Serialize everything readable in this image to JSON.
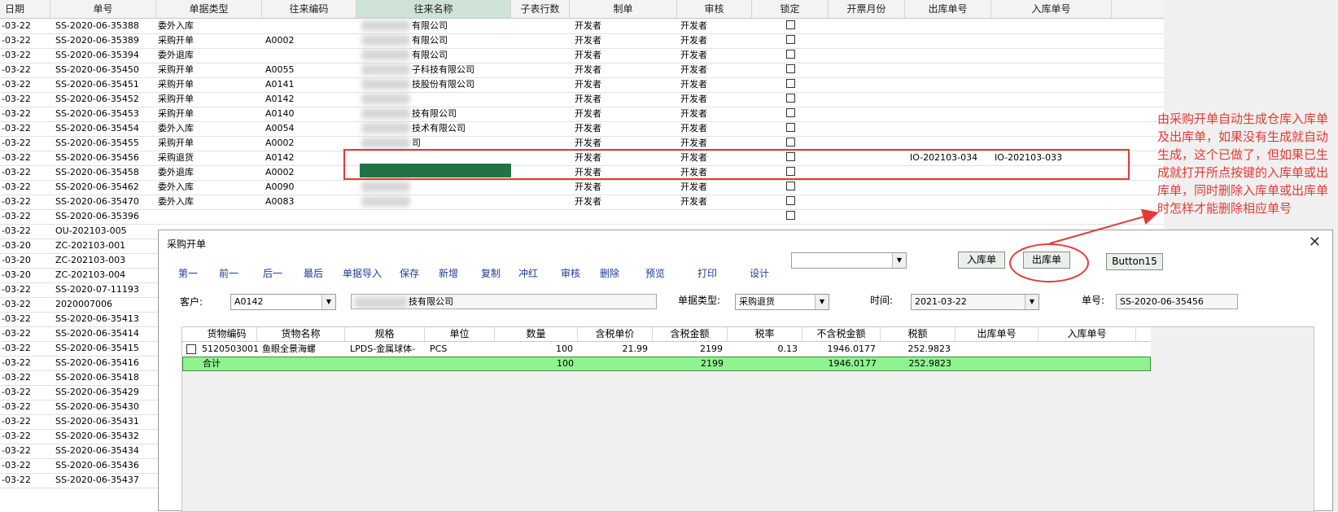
{
  "sheet": {
    "headers": [
      "日期",
      "单号",
      "单据类型",
      "往来编码",
      "往来名称",
      "子表行数",
      "制单",
      "审核",
      "锁定",
      "开票月份",
      "出库单号",
      "入库单号"
    ],
    "rows": [
      {
        "date": "-03-22",
        "no": "SS-2020-06-35388",
        "type": "委外入库",
        "code": "",
        "name": "有限公司",
        "maker": "开发者",
        "auditor": "开发者",
        "out": "",
        "in": ""
      },
      {
        "date": "-03-22",
        "no": "SS-2020-06-35389",
        "type": "采购开单",
        "code": "A0002",
        "name": "有限公司",
        "maker": "开发者",
        "auditor": "开发者",
        "out": "",
        "in": ""
      },
      {
        "date": "-03-22",
        "no": "SS-2020-06-35394",
        "type": "委外退库",
        "code": "",
        "name": "有限公司",
        "maker": "开发者",
        "auditor": "开发者",
        "out": "",
        "in": ""
      },
      {
        "date": "-03-22",
        "no": "SS-2020-06-35450",
        "type": "采购开单",
        "code": "A0055",
        "name": "子科技有限公司",
        "maker": "开发者",
        "auditor": "开发者",
        "out": "",
        "in": ""
      },
      {
        "date": "-03-22",
        "no": "SS-2020-06-35451",
        "type": "采购开单",
        "code": "A0141",
        "name": "技股份有限公司",
        "maker": "开发者",
        "auditor": "开发者",
        "out": "",
        "in": ""
      },
      {
        "date": "-03-22",
        "no": "SS-2020-06-35452",
        "type": "采购开单",
        "code": "A0142",
        "name": "",
        "maker": "开发者",
        "auditor": "开发者",
        "out": "",
        "in": ""
      },
      {
        "date": "-03-22",
        "no": "SS-2020-06-35453",
        "type": "采购开单",
        "code": "A0140",
        "name": "技有限公司",
        "maker": "开发者",
        "auditor": "开发者",
        "out": "",
        "in": ""
      },
      {
        "date": "-03-22",
        "no": "SS-2020-06-35454",
        "type": "委外入库",
        "code": "A0054",
        "name": "技术有限公司",
        "maker": "开发者",
        "auditor": "开发者",
        "out": "",
        "in": ""
      },
      {
        "date": "-03-22",
        "no": "SS-2020-06-35455",
        "type": "采购开单",
        "code": "A0002",
        "name": "司",
        "maker": "开发者",
        "auditor": "开发者",
        "out": "",
        "in": ""
      },
      {
        "date": "-03-22",
        "no": "SS-2020-06-35456",
        "type": "采购退货",
        "code": "A0142",
        "name": "",
        "maker": "开发者",
        "auditor": "开发者",
        "out": "IO-202103-034",
        "in": "IO-202103-033"
      },
      {
        "date": "-03-22",
        "no": "SS-2020-06-35458",
        "type": "委外退库",
        "code": "A0002",
        "name": "",
        "maker": "开发者",
        "auditor": "开发者",
        "out": "",
        "in": ""
      },
      {
        "date": "-03-22",
        "no": "SS-2020-06-35462",
        "type": "委外入库",
        "code": "A0090",
        "name": "",
        "maker": "开发者",
        "auditor": "开发者",
        "out": "",
        "in": ""
      },
      {
        "date": "-03-22",
        "no": "SS-2020-06-35470",
        "type": "委外入库",
        "code": "A0083",
        "name": "",
        "maker": "开发者",
        "auditor": "开发者",
        "out": "",
        "in": ""
      },
      {
        "date": "-03-22",
        "no": "SS-2020-06-35396",
        "type": "",
        "code": "",
        "name": "",
        "maker": "",
        "auditor": "",
        "out": "",
        "in": ""
      },
      {
        "date": "-03-22",
        "no": "OU-202103-005",
        "type": "",
        "code": "",
        "name": "",
        "maker": "",
        "auditor": "",
        "out": "",
        "in": ""
      },
      {
        "date": "-03-20",
        "no": "ZC-202103-001",
        "type": "",
        "code": "",
        "name": "",
        "maker": "",
        "auditor": "",
        "out": "",
        "in": ""
      },
      {
        "date": "-03-20",
        "no": "ZC-202103-003",
        "type": "",
        "code": "",
        "name": "",
        "maker": "",
        "auditor": "",
        "out": "",
        "in": ""
      },
      {
        "date": "-03-20",
        "no": "ZC-202103-004",
        "type": "",
        "code": "",
        "name": "",
        "maker": "",
        "auditor": "",
        "out": "",
        "in": ""
      },
      {
        "date": "-03-22",
        "no": "SS-2020-07-11193",
        "type": "",
        "code": "",
        "name": "",
        "maker": "",
        "auditor": "",
        "out": "",
        "in": ""
      },
      {
        "date": "-03-22",
        "no": "2020007006",
        "type": "",
        "code": "",
        "name": "",
        "maker": "",
        "auditor": "",
        "out": "",
        "in": ""
      },
      {
        "date": "-03-22",
        "no": "SS-2020-06-35413",
        "type": "",
        "code": "",
        "name": "",
        "maker": "",
        "auditor": "",
        "out": "",
        "in": ""
      },
      {
        "date": "-03-22",
        "no": "SS-2020-06-35414",
        "type": "",
        "code": "",
        "name": "",
        "maker": "",
        "auditor": "",
        "out": "",
        "in": ""
      },
      {
        "date": "-03-22",
        "no": "SS-2020-06-35415",
        "type": "",
        "code": "",
        "name": "",
        "maker": "",
        "auditor": "",
        "out": "",
        "in": ""
      },
      {
        "date": "-03-22",
        "no": "SS-2020-06-35416",
        "type": "",
        "code": "",
        "name": "",
        "maker": "",
        "auditor": "",
        "out": "",
        "in": ""
      },
      {
        "date": "-03-22",
        "no": "SS-2020-06-35418",
        "type": "",
        "code": "",
        "name": "",
        "maker": "",
        "auditor": "",
        "out": "",
        "in": ""
      },
      {
        "date": "-03-22",
        "no": "SS-2020-06-35429",
        "type": "",
        "code": "",
        "name": "",
        "maker": "",
        "auditor": "",
        "out": "",
        "in": ""
      },
      {
        "date": "-03-22",
        "no": "SS-2020-06-35430",
        "type": "",
        "code": "",
        "name": "",
        "maker": "",
        "auditor": "",
        "out": "",
        "in": ""
      },
      {
        "date": "-03-22",
        "no": "SS-2020-06-35431",
        "type": "",
        "code": "",
        "name": "",
        "maker": "",
        "auditor": "",
        "out": "",
        "in": ""
      },
      {
        "date": "-03-22",
        "no": "SS-2020-06-35432",
        "type": "",
        "code": "",
        "name": "",
        "maker": "",
        "auditor": "",
        "out": "",
        "in": ""
      },
      {
        "date": "-03-22",
        "no": "SS-2020-06-35434",
        "type": "",
        "code": "",
        "name": "",
        "maker": "",
        "auditor": "",
        "out": "",
        "in": ""
      },
      {
        "date": "-03-22",
        "no": "SS-2020-06-35436",
        "type": "",
        "code": "",
        "name": "",
        "maker": "",
        "auditor": "",
        "out": "",
        "in": ""
      },
      {
        "date": "-03-22",
        "no": "SS-2020-06-35437",
        "type": "",
        "code": "",
        "name": "",
        "maker": "",
        "auditor": "",
        "out": "",
        "in": ""
      }
    ]
  },
  "annotation": {
    "text": "由采购开单自动生成仓库入库单及出库单，如果没有生成就自动生成，这个已做了，但如果已生成就打开所点按键的入库单或出库单，同时删除入库单或出库单时怎样才能删除相应单号",
    "color": "#e53935"
  },
  "dialog": {
    "title": "采购开单",
    "close": "✕",
    "toolbar": [
      "第一",
      "前一",
      "后一",
      "最后",
      "单据导入",
      "保存",
      "新增",
      "复制",
      "冲红",
      "审核",
      "删除",
      "预览",
      "打印",
      "设计"
    ],
    "toolbar_combo": "",
    "btn_in": "入库单",
    "btn_out": "出库单",
    "btn15": "Button15",
    "customer_label": "客户:",
    "customer_code": "A0142",
    "customer_name": "技有限公司",
    "type_label": "单据类型:",
    "type_value": "采购退货",
    "time_label": "时间:",
    "time_value": "2021-03-22",
    "no_label": "单号:",
    "no_value": "SS-2020-06-35456",
    "grid": {
      "headers": [
        "货物编码",
        "货物名称",
        "规格",
        "单位",
        "数量",
        "含税单价",
        "含税金额",
        "税率",
        "不含税金额",
        "税额",
        "出库单号",
        "入库单号"
      ],
      "row": {
        "code": "5120503001",
        "name": "鱼眼全景海螺",
        "spec": "LPDS-金属球体-",
        "unit": "PCS",
        "qty": "100",
        "price": "21.99",
        "amount": "2199",
        "rate": "0.13",
        "net": "1946.0177",
        "tax": "252.9823",
        "out": "",
        "in": ""
      },
      "total": {
        "label": "合计",
        "qty": "100",
        "amount": "2199",
        "net": "1946.0177",
        "tax": "252.9823"
      }
    }
  }
}
